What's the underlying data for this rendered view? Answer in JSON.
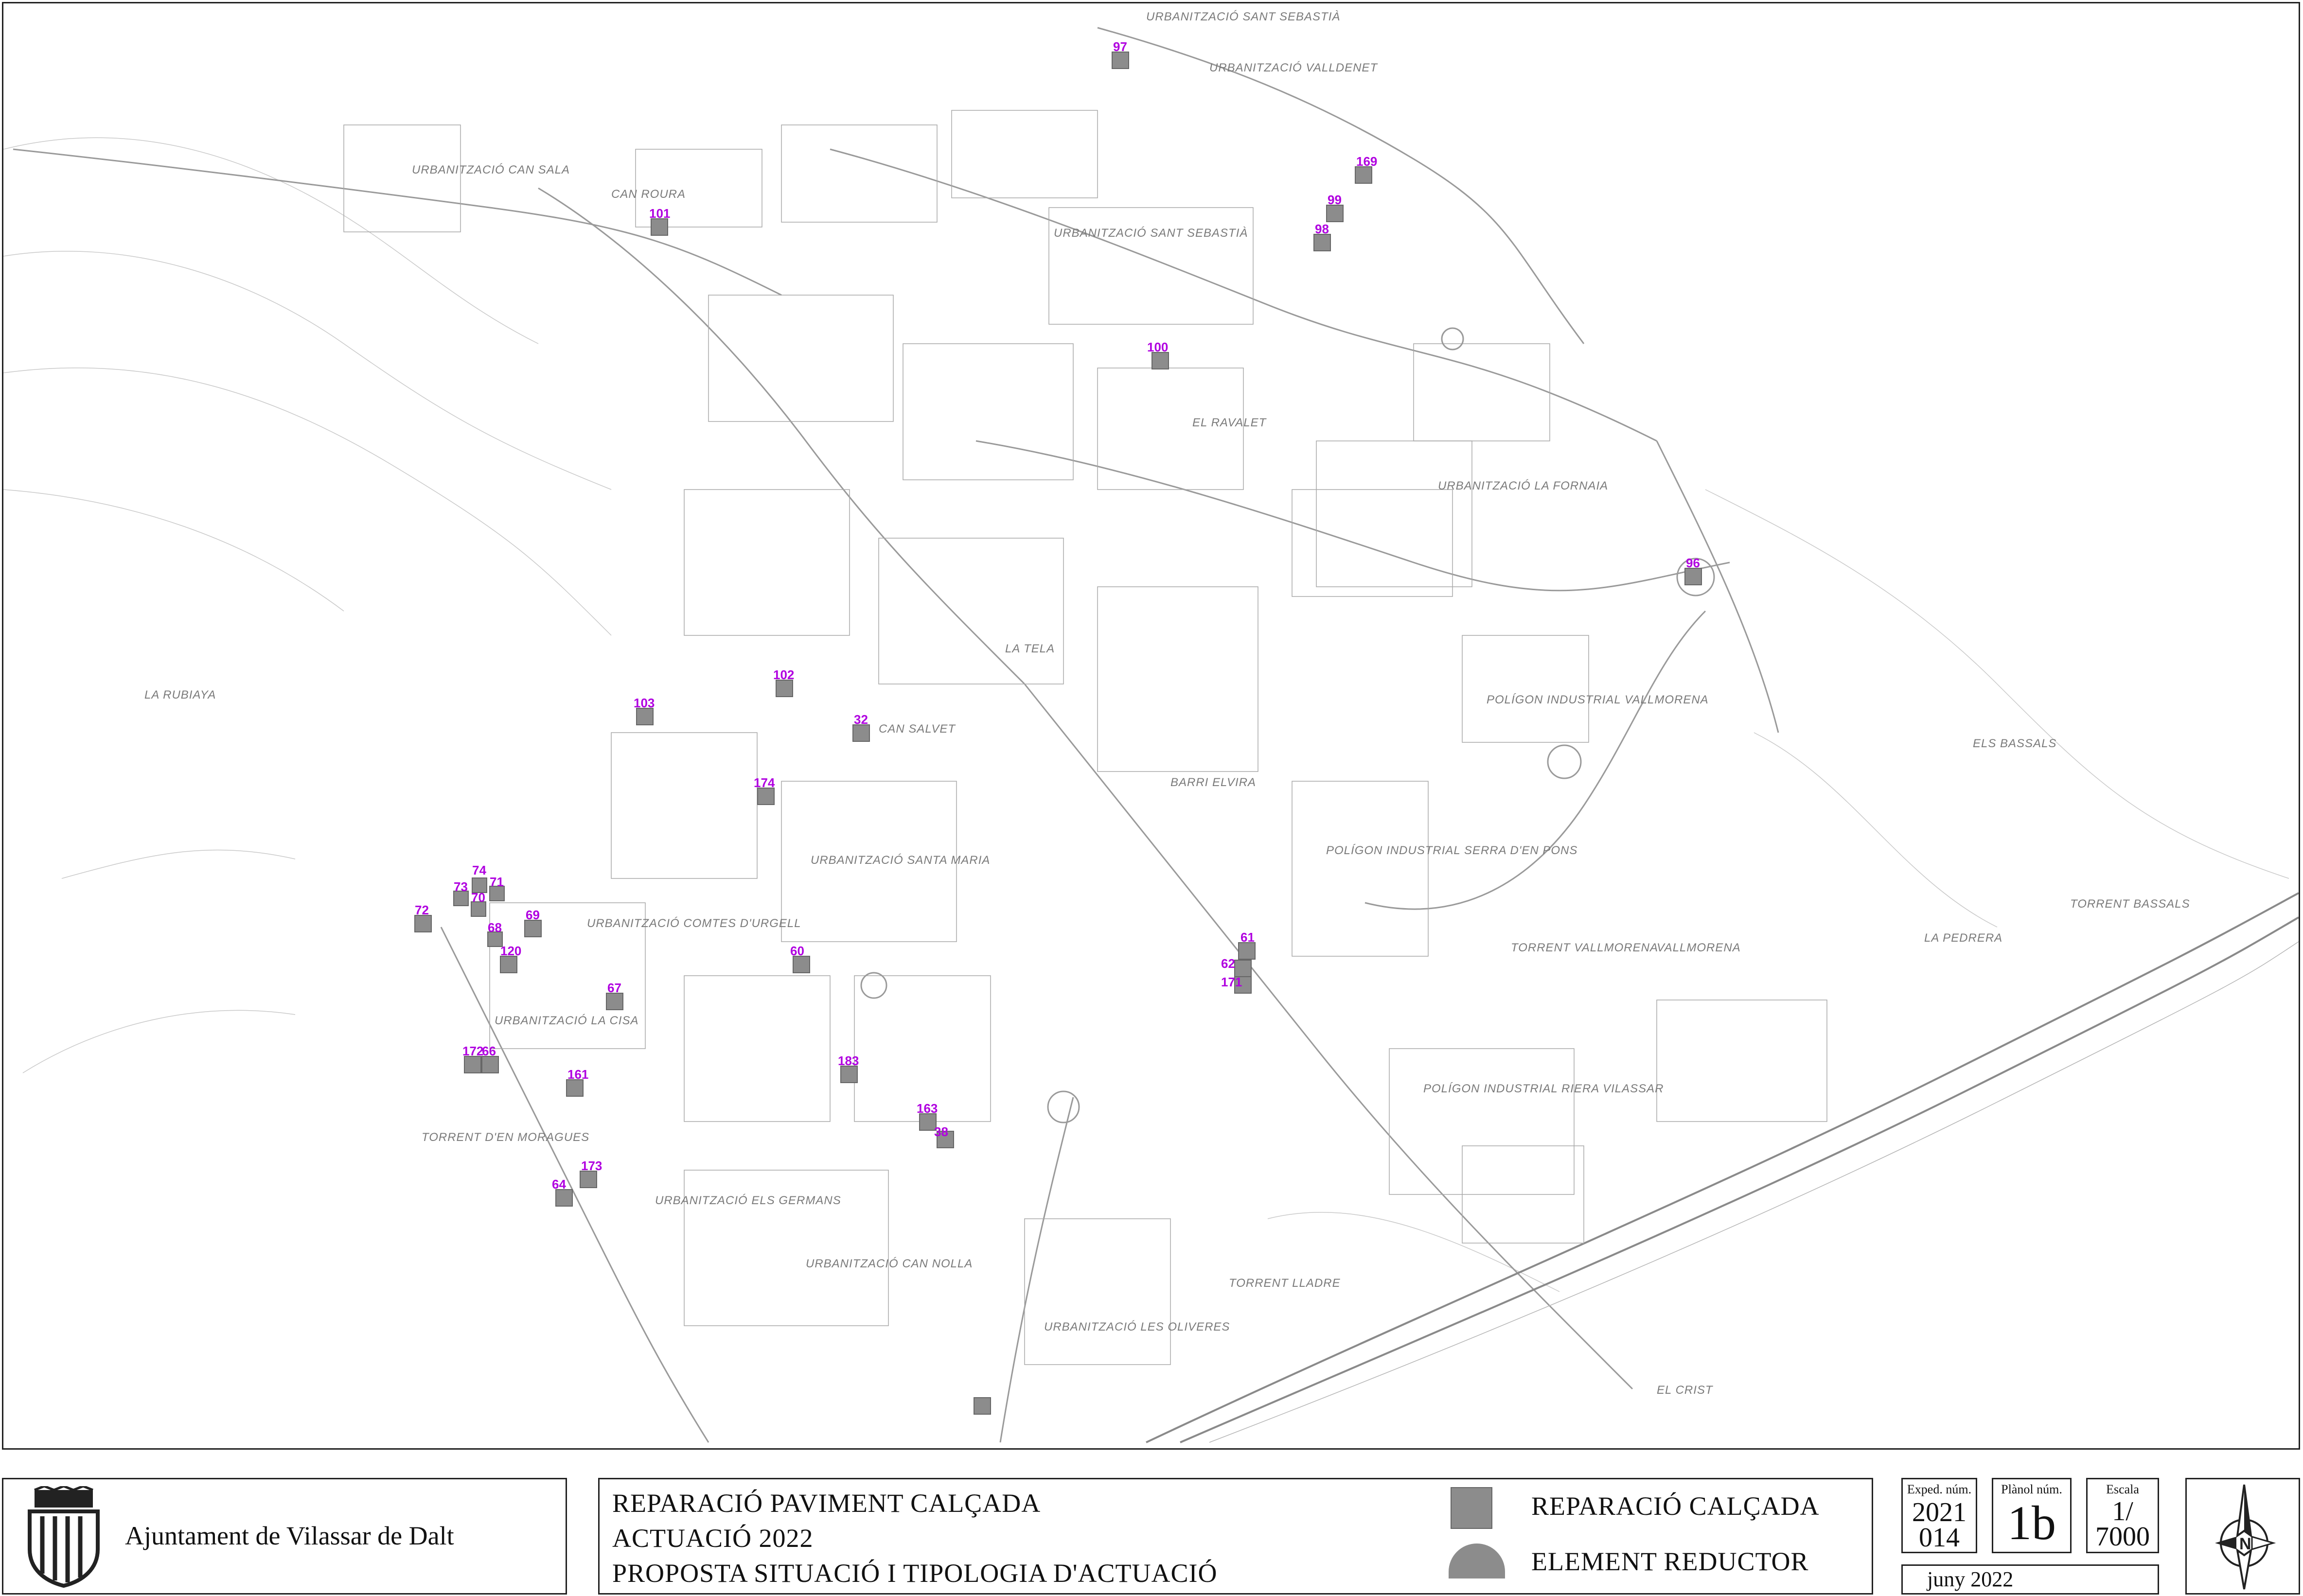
{
  "organization": "Ajuntament de Vilassar de Dalt",
  "title_lines": [
    "REPARACIÓ PAVIMENT CALÇADA",
    "ACTUACIÓ 2022",
    "PROPOSTA SITUACIÓ I TIPOLOGIA D'ACTUACIÓ"
  ],
  "legend": {
    "repair_label": "REPARACIÓ CALÇADA",
    "reducer_label": "ELEMENT REDUCTOR",
    "repair_color": "#8c8c8c"
  },
  "expedient": {
    "caption": "Exped. núm.",
    "year": "2021",
    "number": "014"
  },
  "plan": {
    "caption": "Plànol núm.",
    "value": "1b"
  },
  "scale": {
    "caption": "Escala",
    "numerator": "1/",
    "denominator": "7000"
  },
  "date": "juny 2022",
  "icons": {
    "north_arrow": "compass-north-icon",
    "coat_of_arms": "shield-crest-icon"
  },
  "colors": {
    "marker_label": "#b000e0",
    "marker_fill": "#8c8c8c",
    "map_lines": "#9a9a9a"
  },
  "place_names": [
    "URBANITZACIÓ SANT SEBASTIÀ",
    "URBANITZACIÓ VALLDENET",
    "URBANITZACIÓ CAN SALA",
    "CAN ROURA",
    "URBANITZACIÓ SANT SEBASTIÀ",
    "EL RAVALET",
    "URBANITZACIÓ LA FORNAIA",
    "LA TELA",
    "POLÍGON INDUSTRIAL VALLMORENA",
    "CAN SALVET",
    "BARRI ELVIRA",
    "POLÍGON INDUSTRIAL SERRA D'EN PONS",
    "URBANITZACIÓ SANTA MARIA",
    "URBANITZACIÓ COMTES D'URGELL",
    "URBANITZACIÓ LA CISA",
    "URBANITZACIÓ ELS GERMANS",
    "URBANITZACIÓ CAN NOLLA",
    "URBANITZACIÓ LES OLIVERES",
    "POLÍGON INDUSTRIAL RIERA VILASSAR",
    "LA RUBIAYA",
    "ELS BASSALS",
    "LA PEDRERA",
    "VALLMORENA",
    "TORRENT BASSALS",
    "TORRENT LLADRE",
    "EL CRIST",
    "TORRENT D'EN MORAGUES",
    "TORRENT VALLMORENA"
  ],
  "repair_markers": [
    "97",
    "169",
    "99",
    "98",
    "101",
    "100",
    "96",
    "102",
    "103",
    "32",
    "174",
    "74",
    "73",
    "71",
    "72",
    "70",
    "69",
    "68",
    "120",
    "67",
    "60",
    "61",
    "62",
    "171",
    "172",
    "66",
    "161",
    "183",
    "163",
    "38",
    "173",
    "64"
  ]
}
